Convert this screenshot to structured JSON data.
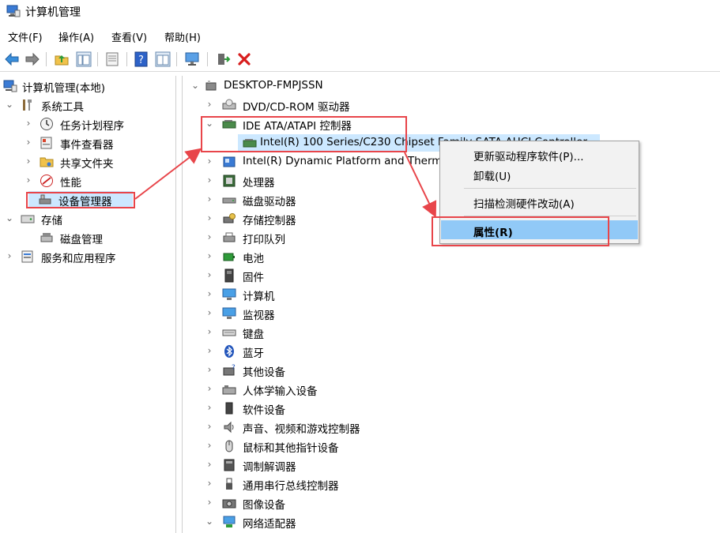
{
  "window": {
    "title": "计算机管理"
  },
  "menu": [
    "文件(F)",
    "操作(A)",
    "查看(V)",
    "帮助(H)"
  ],
  "left_tree": {
    "root": "计算机管理(本地)",
    "system_tools": "系统工具",
    "task_scheduler": "任务计划程序",
    "event_viewer": "事件查看器",
    "shared_folders": "共享文件夹",
    "performance": "性能",
    "device_manager": "设备管理器",
    "storage": "存储",
    "disk_management": "磁盘管理",
    "services_apps": "服务和应用程序"
  },
  "device_tree": {
    "computer_name": "DESKTOP-FMPJSSN",
    "dvd": "DVD/CD-ROM 驱动器",
    "ide": "IDE ATA/ATAPI 控制器",
    "ide_child": "Intel(R) 100 Series/C230 Chipset Family SATA AHCI Controller",
    "dptf": "Intel(R) Dynamic Platform and Thermal Framework",
    "processor": "处理器",
    "disk_drives": "磁盘驱动器",
    "storage_controllers": "存储控制器",
    "print_queues": "打印队列",
    "battery": "电池",
    "firmware": "固件",
    "computer": "计算机",
    "monitors": "监视器",
    "keyboards": "键盘",
    "bluetooth": "蓝牙",
    "other_devices": "其他设备",
    "hid": "人体学输入设备",
    "software_devices": "软件设备",
    "sound": "声音、视频和游戏控制器",
    "mice": "鼠标和其他指针设备",
    "modems": "调制解调器",
    "usb": "通用串行总线控制器",
    "imaging": "图像设备",
    "network": "网络适配器"
  },
  "context_menu": {
    "update_driver": "更新驱动程序软件(P)...",
    "uninstall": "卸载(U)",
    "scan": "扫描检测硬件改动(A)",
    "properties": "属性(R)"
  },
  "colors": {
    "accent_selection": "#cce8ff",
    "highlight_box": "#e8454a",
    "menu_hover": "#91c9f7"
  }
}
